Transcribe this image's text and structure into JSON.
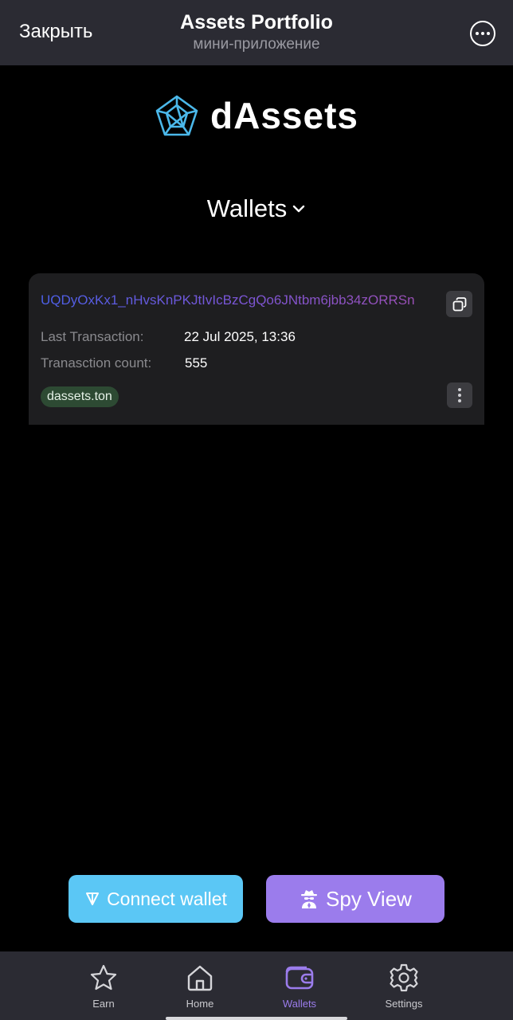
{
  "topbar": {
    "close_label": "Закрыть",
    "title": "Assets Portfolio",
    "subtitle": "мини-приложение"
  },
  "logo": {
    "text": "dAssets"
  },
  "wallets_selector": {
    "label": "Wallets"
  },
  "wallet_card": {
    "address": "UQDyOxKx1_nHvsKnPKJtIvIcBzCgQo6JNtbm6jbb34zORRSn",
    "last_transaction_label": "Last Transaction:",
    "last_transaction_value": "22 Jul 2025, 13:36",
    "transaction_count_label": "Tranasction count:",
    "transaction_count_value": "555",
    "domain_tag": "dassets.ton"
  },
  "actions": {
    "connect_label": "Connect wallet",
    "spy_label": "Spy View"
  },
  "bottom_nav": {
    "items": [
      {
        "label": "Earn",
        "icon": "star-icon"
      },
      {
        "label": "Home",
        "icon": "home-icon"
      },
      {
        "label": "Wallets",
        "icon": "wallet-icon",
        "active": true
      },
      {
        "label": "Settings",
        "icon": "gear-icon"
      }
    ]
  },
  "colors": {
    "accent_purple": "#9b7cec",
    "accent_blue": "#5bc7f5",
    "tag_green": "#2d4a33",
    "bar_bg": "#2b2b33"
  }
}
